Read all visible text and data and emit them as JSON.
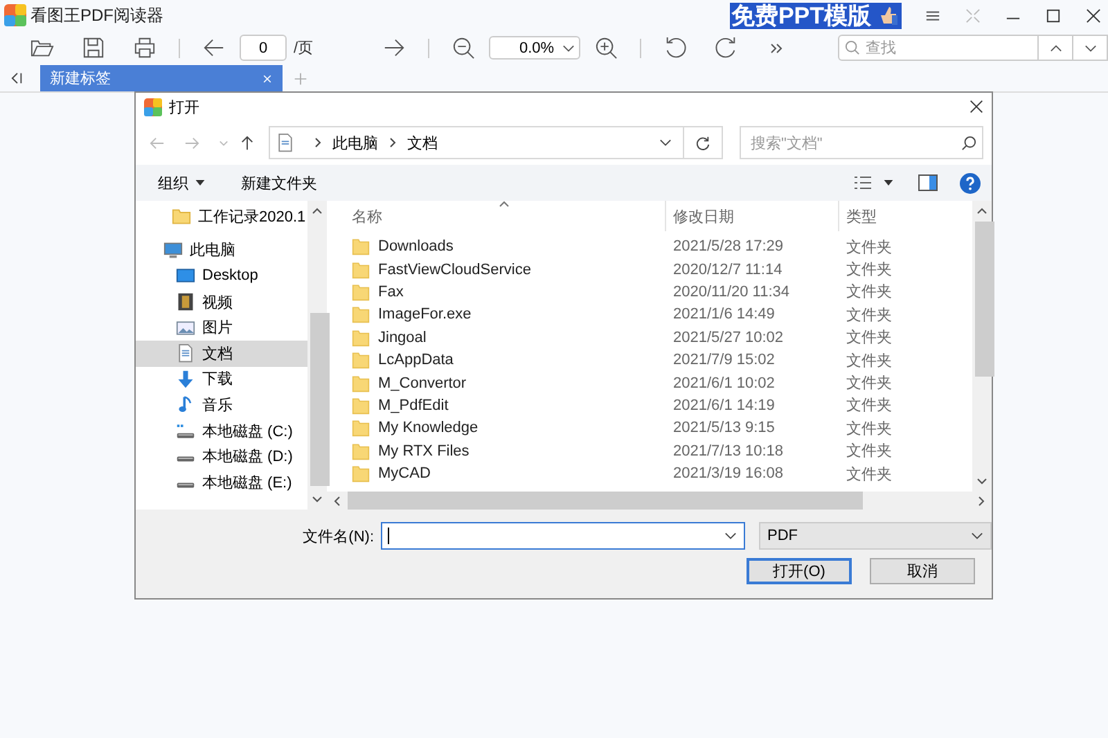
{
  "app": {
    "title": "看图王PDF阅读器",
    "ad": "免费PPT模版"
  },
  "toolbar": {
    "page": "0",
    "page_suffix": "/页",
    "zoom": "0.0%",
    "search_placeholder": "查找"
  },
  "tabs": [
    {
      "label": "新建标签",
      "selected": true
    }
  ],
  "dialog": {
    "title": "打开",
    "breadcrumb": [
      "此电脑",
      "文档"
    ],
    "search_placeholder": "搜索\"文档\"",
    "commands": [
      {
        "label": "组织",
        "dropdown": true
      },
      {
        "label": "新建文件夹",
        "dropdown": false
      }
    ],
    "nav_pane": [
      {
        "label": "工作记录2020.1",
        "kind": "folder",
        "selected": false
      },
      {
        "label": "此电脑",
        "kind": "computer",
        "selected": false,
        "children": [
          {
            "label": "Desktop",
            "kind": "desktop",
            "selected": false
          },
          {
            "label": "视频",
            "kind": "video",
            "selected": false
          },
          {
            "label": "图片",
            "kind": "picture",
            "selected": false
          },
          {
            "label": "文档",
            "kind": "document",
            "selected": true
          },
          {
            "label": "下载",
            "kind": "download",
            "selected": false
          },
          {
            "label": "音乐",
            "kind": "music",
            "selected": false
          },
          {
            "label": "本地磁盘 (C:)",
            "kind": "system-drive",
            "selected": false
          },
          {
            "label": "本地磁盘 (D:)",
            "kind": "drive",
            "selected": false
          },
          {
            "label": "本地磁盘 (E:)",
            "kind": "drive",
            "selected": false
          }
        ]
      }
    ],
    "columns": [
      "名称",
      "修改日期",
      "类型"
    ],
    "rows": [
      {
        "name": "Downloads",
        "date": "2021/5/28 17:29",
        "type": "文件夹"
      },
      {
        "name": "FastViewCloudService",
        "date": "2020/12/7 11:14",
        "type": "文件夹"
      },
      {
        "name": "Fax",
        "date": "2020/11/20 11:34",
        "type": "文件夹"
      },
      {
        "name": "ImageFor.exe",
        "date": "2021/1/6 14:49",
        "type": "文件夹"
      },
      {
        "name": "Jingoal",
        "date": "2021/5/27 10:02",
        "type": "文件夹"
      },
      {
        "name": "LcAppData",
        "date": "2021/7/9 15:02",
        "type": "文件夹"
      },
      {
        "name": "M_Convertor",
        "date": "2021/6/1 10:02",
        "type": "文件夹"
      },
      {
        "name": "M_PdfEdit",
        "date": "2021/6/1 14:19",
        "type": "文件夹"
      },
      {
        "name": "My Knowledge",
        "date": "2021/5/13 9:15",
        "type": "文件夹"
      },
      {
        "name": "My RTX Files",
        "date": "2021/7/13 10:18",
        "type": "文件夹"
      },
      {
        "name": "MyCAD",
        "date": "2021/3/19 16:08",
        "type": "文件夹"
      }
    ],
    "filename_label": "文件名(N):",
    "file_type": "PDF",
    "buttons": [
      {
        "label": "打开(O)",
        "default": true
      },
      {
        "label": "取消",
        "default": false
      }
    ]
  }
}
